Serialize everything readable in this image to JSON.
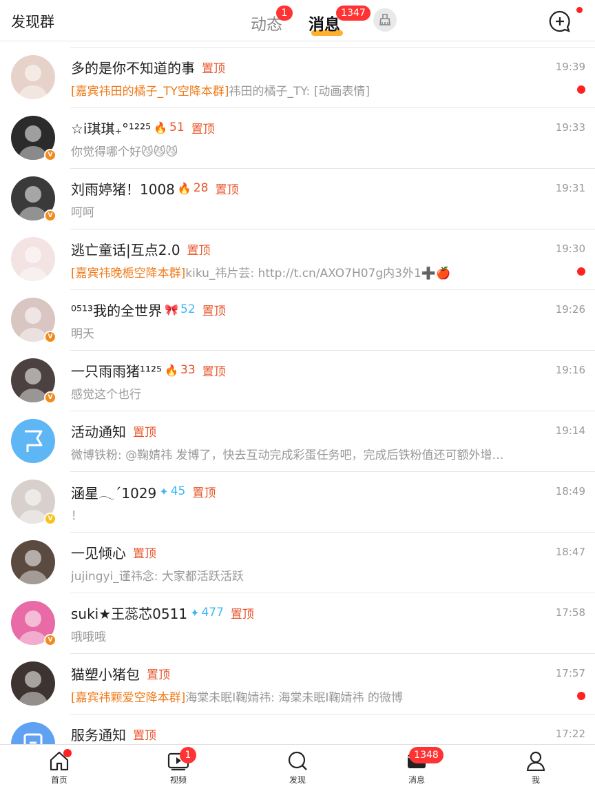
{
  "header": {
    "left_title": "发现群",
    "tabs": [
      {
        "label": "动态",
        "badge": "1"
      },
      {
        "label": "消息",
        "badge": "1347"
      }
    ],
    "broom_icon": "broom-icon",
    "new_chat_icon": "new-chat-icon"
  },
  "conversations": [
    {
      "name": "多的是你不知道的事",
      "fire": "",
      "fans": "",
      "pin": "置顶",
      "time": "19:39",
      "group": "[嘉宾祎田的橘子_TY空降本群]",
      "preview": "祎田的橘子_TY: [动画表情]",
      "unread_dot": true,
      "verified": "",
      "avatar_color": "#e7d2c9"
    },
    {
      "name": "☆i琪琪₊°¹²²⁵",
      "fire": "🔥",
      "fans": "51",
      "pin": "置顶",
      "time": "19:33",
      "group": "",
      "preview": "你觉得哪个好😼😼😼",
      "unread_dot": false,
      "verified": "orange",
      "avatar_color": "#2b2b2b"
    },
    {
      "name": "刘雨婷猪！1008",
      "fire": "🔥",
      "fans": "28",
      "pin": "置顶",
      "time": "19:31",
      "group": "",
      "preview": "呵呵",
      "unread_dot": false,
      "verified": "orange",
      "avatar_color": "#3a3a3a"
    },
    {
      "name": "逃亡童话|互点2.0",
      "fire": "",
      "fans": "",
      "pin": "置顶",
      "time": "19:30",
      "group": "[嘉宾祎晚栀空降本群]",
      "preview": "kiku_祎片芸: http://t.cn/AXO7H07g内3外1➕🍎",
      "unread_dot": true,
      "verified": "",
      "avatar_color": "#f3e3e3"
    },
    {
      "name": "⁰⁵¹³我的全世界",
      "fire": "🎀",
      "fans": "52",
      "pin": "置顶",
      "time": "19:26",
      "group": "",
      "preview": "明天",
      "unread_dot": false,
      "verified": "orange",
      "avatar_color": "#d9c6c3"
    },
    {
      "name": "一只雨雨猪¹¹²⁵",
      "fire": "🔥",
      "fans": "33",
      "pin": "置顶",
      "time": "19:16",
      "group": "",
      "preview": "感觉这个也行",
      "unread_dot": false,
      "verified": "orange",
      "avatar_color": "#4a4140"
    },
    {
      "name": "活动通知",
      "fire": "",
      "fans": "",
      "pin": "置顶",
      "time": "19:14",
      "group": "",
      "preview": "微博铁粉: @鞠婧祎 发博了，快去互动完成彩蛋任务吧，完成后铁粉值还可额外增…",
      "unread_dot": false,
      "verified": "",
      "avatar_color": "#5fb6f5",
      "icon": "flag-icon"
    },
    {
      "name": "涵星𓂃ˊ1029",
      "fire": "✦",
      "fans": "45",
      "pin": "置顶",
      "time": "18:49",
      "group": "",
      "preview": "！",
      "unread_dot": false,
      "verified": "yellow",
      "avatar_color": "#d8d0cc"
    },
    {
      "name": "一见倾心",
      "fire": "",
      "fans": "",
      "pin": "置顶",
      "time": "18:47",
      "group": "",
      "preview": "jujingyi_谨祎念: 大家都活跃活跃",
      "unread_dot": false,
      "verified": "",
      "avatar_color": "#5a4a40"
    },
    {
      "name": "suki★王蕊芯0511",
      "fire": "✦",
      "fans": "477",
      "pin": "置顶",
      "time": "17:58",
      "group": "",
      "preview": "哦哦哦",
      "unread_dot": false,
      "verified": "orange",
      "avatar_color": "#e86aa6"
    },
    {
      "name": "猫塑小猪包",
      "fire": "",
      "fans": "",
      "pin": "置顶",
      "time": "17:57",
      "group": "[嘉宾祎颗爱空降本群]",
      "preview": "海棠未眠I鞠婧祎: 海棠未眠I鞠婧祎 的微博",
      "unread_dot": true,
      "verified": "",
      "avatar_color": "#3d3330"
    },
    {
      "name": "服务通知",
      "fire": "",
      "fans": "",
      "pin": "置顶",
      "time": "17:22",
      "group": "",
      "preview": "",
      "unread_dot": false,
      "verified": "",
      "avatar_color": "#5fa2f2",
      "icon": "service-icon"
    }
  ],
  "colors": {
    "fire": "#ff6a2a",
    "fans_fire": "#e8542b",
    "fans_blue": "#3fb7f5",
    "pin": "#e8542b",
    "group": "#ee7a18"
  },
  "bottom_nav": [
    {
      "label": "首页",
      "icon": "home-icon"
    },
    {
      "label": "视频",
      "icon": "video-icon",
      "badge": "1"
    },
    {
      "label": "发现",
      "icon": "search-icon"
    },
    {
      "label": "消息",
      "icon": "message-icon",
      "badge": "1348"
    },
    {
      "label": "我",
      "icon": "profile-icon"
    }
  ]
}
